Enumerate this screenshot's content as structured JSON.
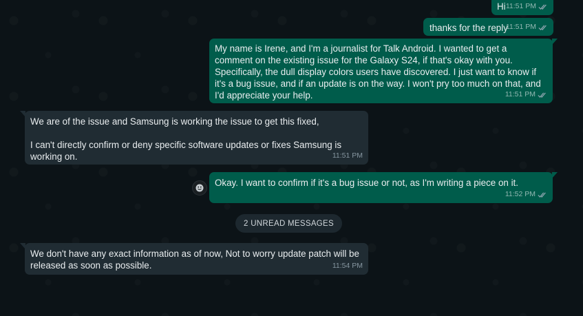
{
  "theme": {
    "background": "#0c1317",
    "outgoing_bubble": "#005c4b",
    "incoming_bubble": "#202c33",
    "tick_color": "#8fa6b0"
  },
  "messages": [
    {
      "direction": "outgoing",
      "text": "Hi",
      "time": "11:51 PM",
      "status": "read-double-tick"
    },
    {
      "direction": "outgoing",
      "text": "thanks for the reply",
      "time": "11:51 PM",
      "status": "read-double-tick"
    },
    {
      "direction": "outgoing",
      "text": "My name is Irene, and I'm a journalist for Talk Android. I wanted to get a comment on the existing issue for the Galaxy S24, if that's okay with you.\nSpecifically, the dull display colors users have discovered. I just want to know if it's a bug issue, and if an update is on the way. I won't pry too much on that, and I'd appreciate your help.",
      "time": "11:51 PM",
      "status": "read-double-tick"
    },
    {
      "direction": "incoming",
      "text": "We are of the issue and Samsung is working the issue to get this fixed,\n\nI can't directly confirm or deny specific software updates or fixes Samsung is working on.",
      "time": "11:51 PM"
    },
    {
      "direction": "outgoing",
      "text": "Okay. I want to confirm if it's a bug issue or not, as I'm writing a piece on it.",
      "time": "11:52 PM",
      "status": "read-double-tick",
      "sender_icon": "smiley-avatar-icon"
    },
    {
      "direction": "incoming",
      "text": "We don't have any exact information as of now, Not to worry update patch will be released as soon as possible.",
      "time": "11:54 PM"
    }
  ],
  "unread_divider": {
    "label": "2 UNREAD MESSAGES"
  }
}
